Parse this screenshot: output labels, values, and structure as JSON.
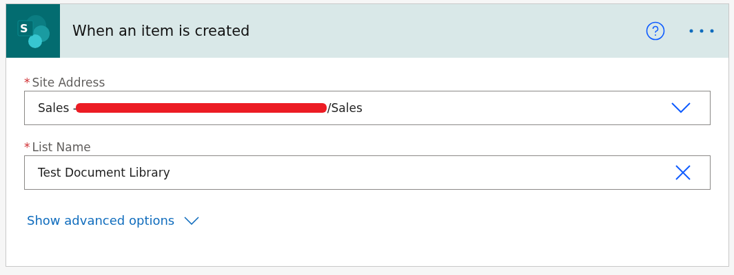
{
  "trigger": {
    "logo_letter": "S",
    "title": "When an item is created"
  },
  "fields": [
    {
      "label": "Site Address",
      "required_mark": "*",
      "kind": "dropdown",
      "value_start": "Sales -",
      "value_end": "/Sales",
      "redacted": true
    },
    {
      "label": "List Name",
      "required_mark": "*",
      "kind": "clearable",
      "value_start": "Test Document Library"
    }
  ],
  "advanced_link": "Show advanced options"
}
